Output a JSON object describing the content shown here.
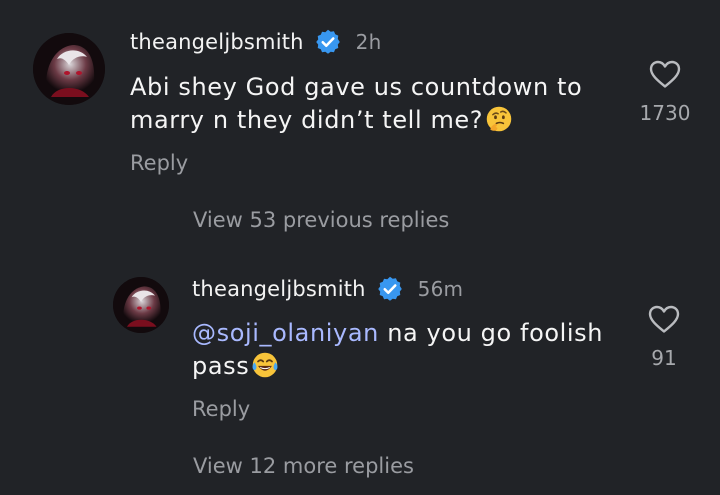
{
  "comments": [
    {
      "username": "theangeljbsmith",
      "timestamp": "2h",
      "text_line1": "Abi shey God gave us countdown to",
      "text_line2": "marry n they didn’t tell me?",
      "emoji": "thinking-face",
      "likes": "1730",
      "reply_label": "Reply"
    },
    {
      "username": "theangeljbsmith",
      "timestamp": "56m",
      "mention": "@soji_olaniyan",
      "text_line1": " na you go foolish",
      "text_line2": "pass",
      "emoji": "tears-of-joy-face",
      "likes": "91",
      "reply_label": "Reply"
    }
  ],
  "view_previous_replies": "View 53 previous replies",
  "view_more_replies": "View 12 more replies",
  "colors": {
    "background": "#212327",
    "verified_badge": "#3897f0",
    "mention": "#a9b9ff",
    "muted_text": "#9a9ca1"
  }
}
